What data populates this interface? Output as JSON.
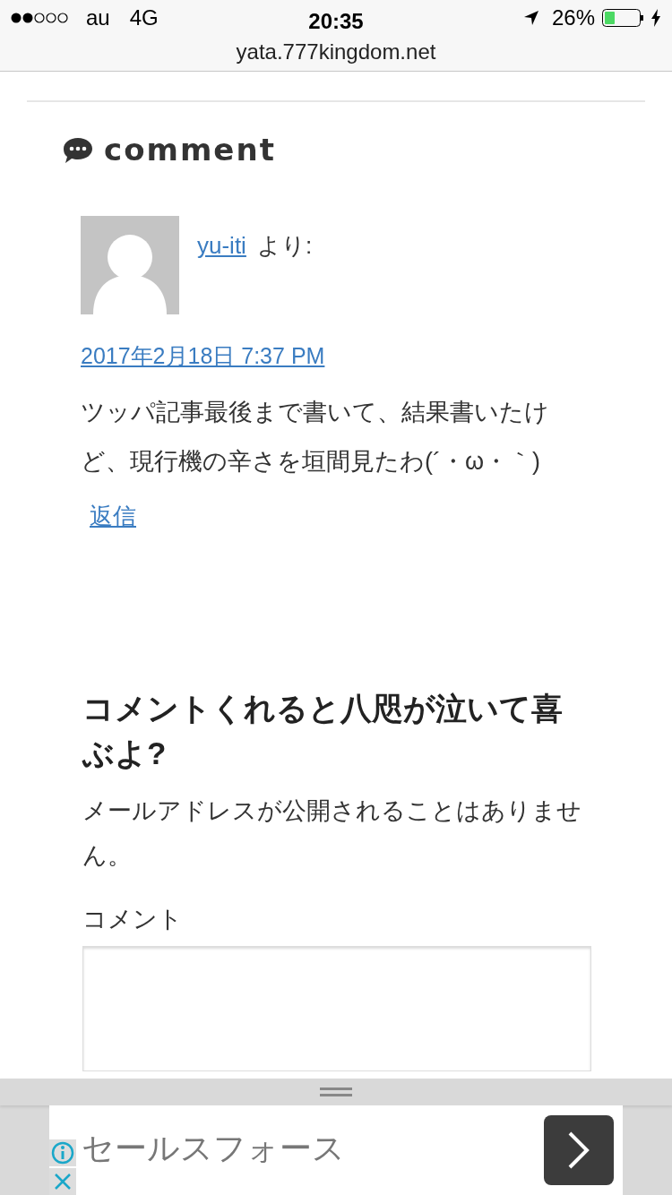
{
  "status_bar": {
    "carrier": "au",
    "network": "4G",
    "time": "20:35",
    "battery": "26%",
    "charging": true
  },
  "address_bar": {
    "url": "yata.777kingdom.net"
  },
  "section_title": "comment",
  "comments": [
    {
      "author": "yu-iti",
      "author_suffix": "より:",
      "date": "2017年2月18日 7:37 PM",
      "body": "ツッパ記事最後まで書いて、結果書いたけど、現行機の辛さを垣間見たわ(´・ω・｀)",
      "reply": "返信"
    }
  ],
  "form": {
    "title": "コメントくれると八咫が泣いて喜ぶよ?",
    "note": "メールアドレスが公開されることはありません。",
    "comment_label": "コメント"
  },
  "ad": {
    "text": "セールスフォース"
  }
}
